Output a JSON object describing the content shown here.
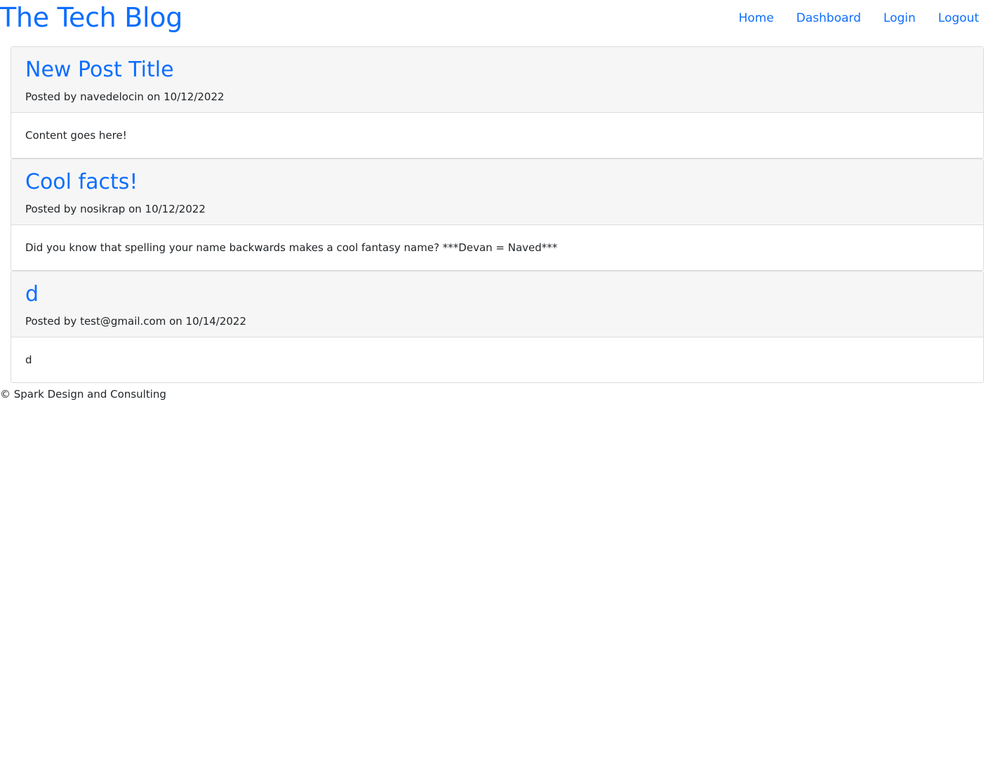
{
  "header": {
    "site_title": "The Tech Blog",
    "nav": [
      {
        "label": "Home"
      },
      {
        "label": "Dashboard"
      },
      {
        "label": "Login"
      },
      {
        "label": "Logout"
      }
    ]
  },
  "posts": [
    {
      "title": "New Post Title",
      "meta": "Posted by navedelocin on 10/12/2022",
      "content": "Content goes here!"
    },
    {
      "title": "Cool facts!",
      "meta": "Posted by nosikrap on 10/12/2022",
      "content": "Did you know that spelling your name backwards makes a cool fantasy name? ***Devan = Naved***"
    },
    {
      "title": "d",
      "meta": "Posted by test@gmail.com on 10/14/2022",
      "content": "d"
    }
  ],
  "footer": {
    "text": "© Spark Design and Consulting"
  },
  "colors": {
    "accent": "#0d6efd",
    "card_header_bg": "#f6f6f6",
    "border": "#dcdcdc"
  }
}
